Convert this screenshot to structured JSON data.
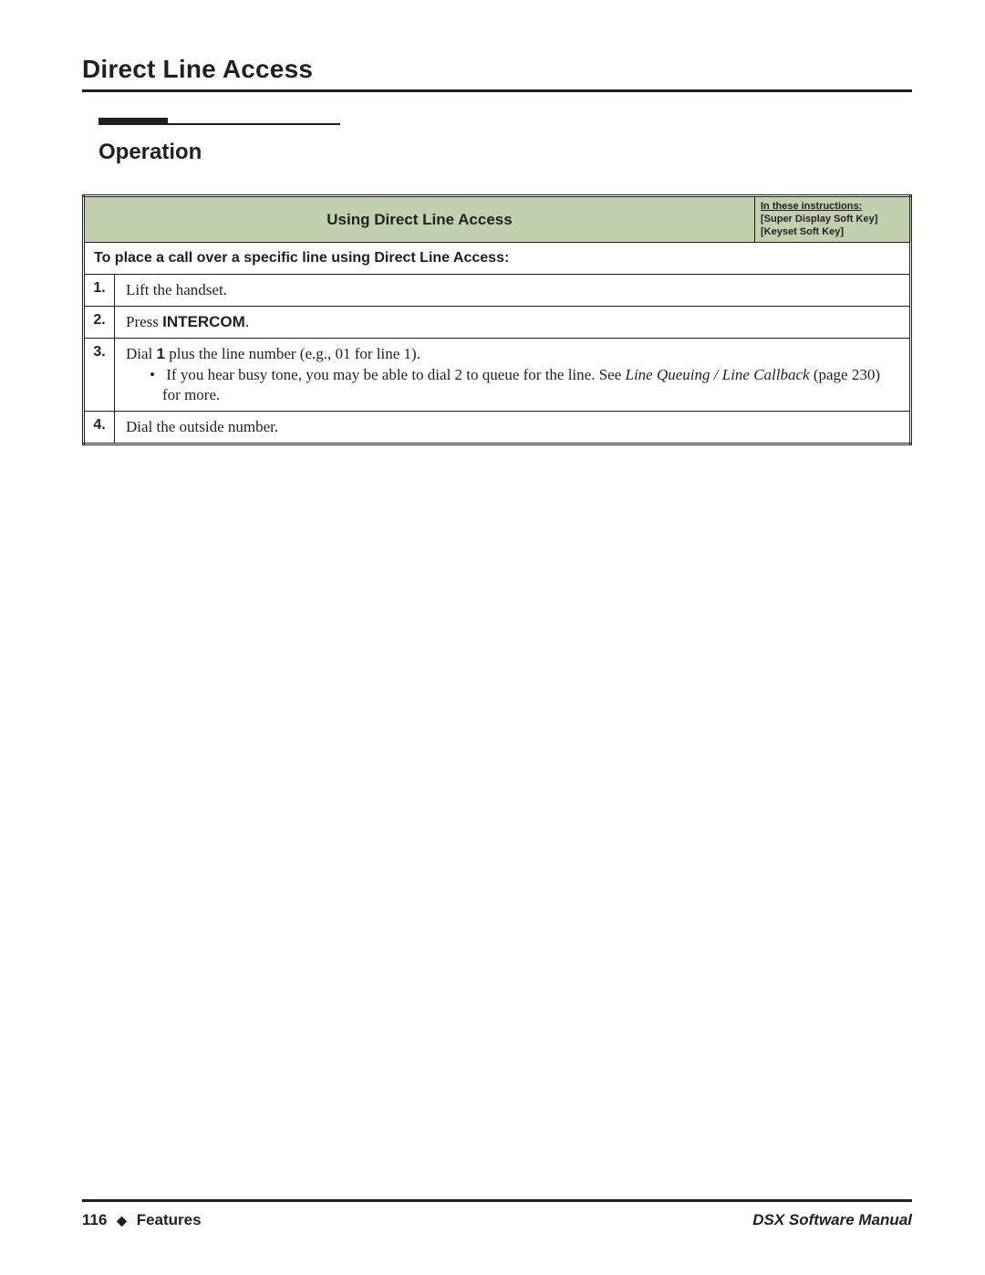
{
  "header": {
    "page_title": "Direct Line Access",
    "section_title": "Operation"
  },
  "table": {
    "title": "Using Direct Line Access",
    "legend": {
      "heading": "In these instructions:",
      "line1": "[Super Display Soft Key]",
      "line2": "[Keyset Soft Key]"
    },
    "subheading": "To place a call over a specific line using Direct Line Access:",
    "steps": [
      {
        "num": "1.",
        "text": "Lift the handset."
      },
      {
        "num": "2.",
        "prefix": "Press ",
        "bold": "INTERCOM",
        "suffix": "."
      },
      {
        "num": "3.",
        "line1_prefix": "Dial ",
        "line1_bold": "1",
        "line1_suffix": " plus the line number (e.g., 01 for line 1).",
        "bullet_prefix": "If you hear busy tone, you may be able to dial 2 to queue for the line. See ",
        "bullet_italic": "Line Queuing / Line Callback",
        "bullet_suffix": " (page 230) for more."
      },
      {
        "num": "4.",
        "text": "Dial the outside number."
      }
    ]
  },
  "footer": {
    "page_number": "116",
    "section": "Features",
    "manual": "DSX Software Manual"
  }
}
